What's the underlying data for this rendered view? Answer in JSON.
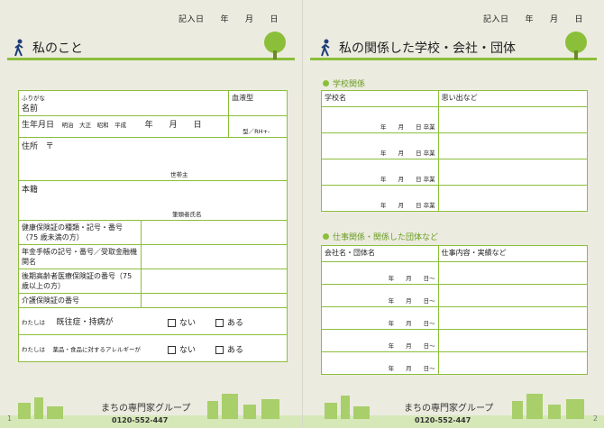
{
  "left": {
    "date": {
      "label": "記入日",
      "y": "年",
      "m": "月",
      "d": "日"
    },
    "title": "私のこと",
    "rows": {
      "furigana": "ふりがな",
      "name": "名前",
      "blood": "血液型",
      "birth": "生年月日",
      "eras": "明治　大正　昭和　平成",
      "ymd": "年　　月　　日",
      "blood_type": "型／RH+-",
      "address": "住所",
      "postal": "〒",
      "household": "世帯主",
      "honseki": "本籍",
      "head": "筆頭者氏名",
      "insurance": "健康保険証の種類・記号・番号（75 歳未満の方）",
      "pension": "年金手帳の記号・番号／受取金融機関名",
      "elderly": "後期高齢者医療保険証の番号（75 歳以上の方）",
      "care": "介護保険証の番号",
      "history_prefix": "わたしは",
      "history": "既往症・持病が",
      "allergy_prefix": "わたしは",
      "allergy": "薬品・食品に対するアレルギーが",
      "no": "ない",
      "yes": "ある"
    },
    "footer": {
      "brand": "まちの専門家グループ",
      "phone": "0120-552-447",
      "page": "1"
    }
  },
  "right": {
    "date": {
      "label": "記入日",
      "y": "年",
      "m": "月",
      "d": "日"
    },
    "title": "私の関係した学校・会社・団体",
    "school_section": "学校関係",
    "school_headers": [
      "学校名",
      "思い出など"
    ],
    "school_row": "年　　月　　日 卒業",
    "work_section": "仕事関係・関係した団体など",
    "work_headers": [
      "会社名・団体名",
      "仕事内容・実績など"
    ],
    "work_row": "年　　月　　日〜",
    "footer": {
      "brand": "まちの専門家グループ",
      "phone": "0120-552-447",
      "page": "2"
    }
  }
}
